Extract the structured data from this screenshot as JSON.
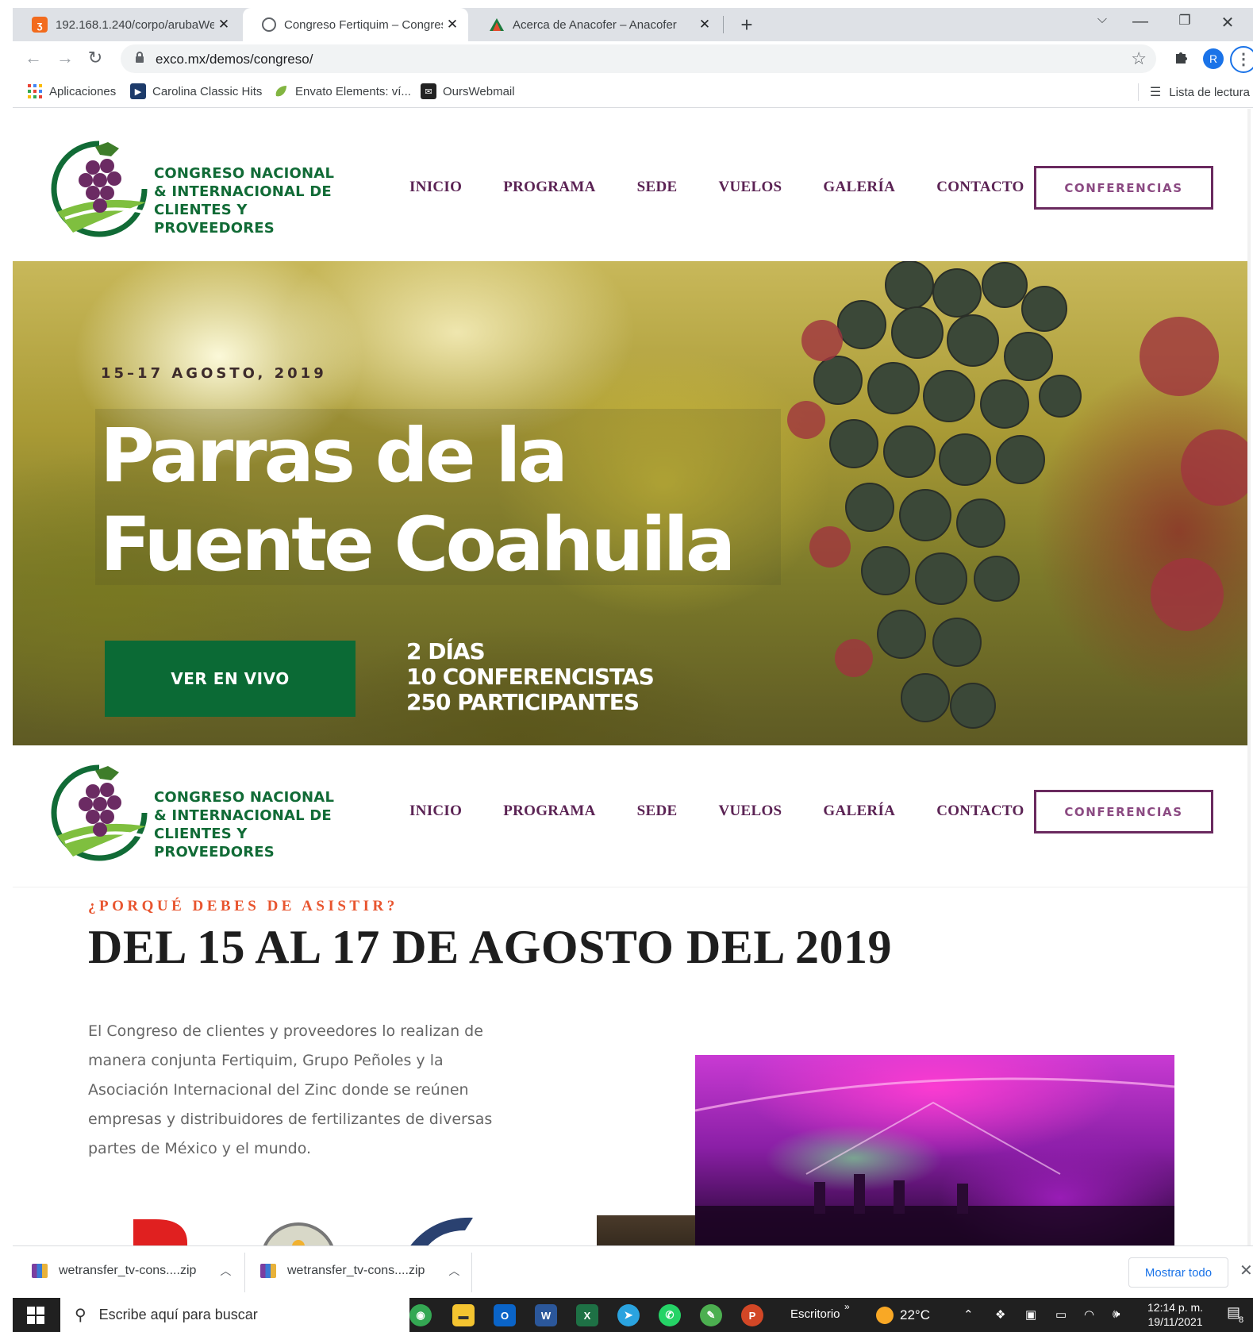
{
  "browser": {
    "tabs": [
      {
        "title": "192.168.1.240/corpo/arubaWelco",
        "close": "✕"
      },
      {
        "title": "Congreso Fertiquim – Congreso N",
        "close": "✕"
      },
      {
        "title": "Acerca de Anacofer – Anacofer",
        "close": "✕"
      }
    ],
    "new_tab": "+",
    "url": "exco.mx/demos/congreso/",
    "profile_initial": "R",
    "bookmarks": [
      {
        "label": "Aplicaciones"
      },
      {
        "label": "Carolina Classic Hits"
      },
      {
        "label": "Envato Elements: ví..."
      },
      {
        "label": "OursWebmail"
      }
    ],
    "reading_list": "Lista de lectura"
  },
  "site": {
    "logo_lines": [
      "CONGRESO NACIONAL",
      "& INTERNACIONAL DE",
      "CLIENTES Y PROVEEDORES"
    ],
    "menu": [
      "INICIO",
      "PROGRAMA",
      "SEDE",
      "VUELOS",
      "GALERÍA",
      "CONTACTO"
    ],
    "cta": "CONFERENCIAS",
    "hero": {
      "date": "15–17 AGOSTO, 2019",
      "title_line1": "Parras de la",
      "title_line2": "Fuente Coahuila",
      "button": "VER EN VIVO",
      "stats": [
        "2 DÍAS",
        "10 CONFERENCISTAS",
        "250 PARTICIPANTES"
      ]
    },
    "section": {
      "kicker": "¿PORQUÉ DEBES DE ASISTIR?",
      "headline": "DEL 15 AL 17 DE AGOSTO DEL 2019",
      "paragraph": "El Congreso de clientes y proveedores lo realizan de manera conjunta Fertiquim, Grupo Peñoles y la Asociación Internacional del Zinc donde se reúnen empresas y distribuidores de fertilizantes de diversas partes de México y el mundo."
    }
  },
  "downloads": {
    "items": [
      "wetransfer_tv-cons....zip",
      "wetransfer_tv-cons....zip"
    ],
    "show_all": "Mostrar todo"
  },
  "taskbar": {
    "search_placeholder": "Escribe aquí para buscar",
    "desktop_label": "Escritorio",
    "weather": "22°C",
    "time": "12:14 p. m.",
    "date": "19/11/2021",
    "notification_count": "8"
  },
  "colors": {
    "brand_green": "#116b36",
    "menu_purple": "#5b2354",
    "cta_purple": "#6a2a5f",
    "kicker_orange": "#e8552f",
    "live_button": "#0b6a35"
  }
}
